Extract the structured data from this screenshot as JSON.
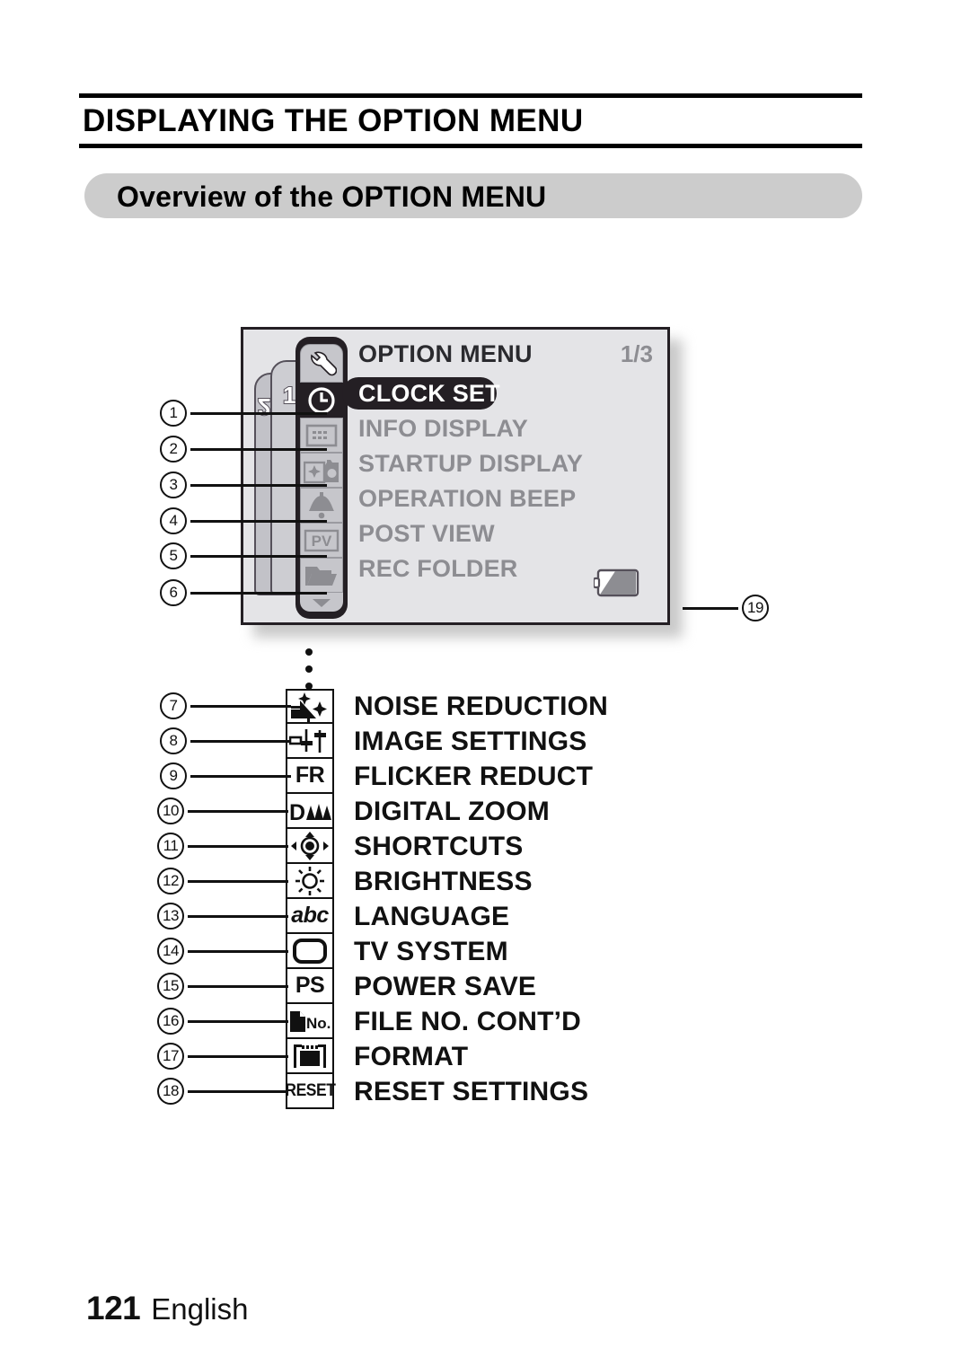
{
  "header": {
    "title": "DISPLAYING THE OPTION MENU",
    "section_title": "Overview of the OPTION MENU"
  },
  "lcd": {
    "menu_title": "OPTION MENU",
    "page_indicator": "1/3",
    "tabs": [
      "1",
      "2"
    ],
    "rows": [
      {
        "num": "1",
        "icon": "clock-icon",
        "label": "CLOCK SET",
        "selected": true
      },
      {
        "num": "2",
        "icon": "info-display-icon",
        "label": "INFO DISPLAY",
        "selected": false
      },
      {
        "num": "3",
        "icon": "startup-display-icon",
        "label": "STARTUP DISPLAY",
        "selected": false
      },
      {
        "num": "4",
        "icon": "bell-icon",
        "label": "OPERATION BEEP",
        "selected": false
      },
      {
        "num": "5",
        "icon": "pv-icon",
        "label": "POST VIEW",
        "selected": false
      },
      {
        "num": "6",
        "icon": "folder-icon",
        "label": "REC FOLDER",
        "selected": false
      }
    ],
    "top_icon": "wrench-icon",
    "scroll_icon": "chevron-down-icon",
    "battery": {
      "callout": "19",
      "icon": "battery-icon"
    }
  },
  "lower_list": [
    {
      "num": "7",
      "icon": "noise-reduction-icon",
      "label": "NOISE REDUCTION"
    },
    {
      "num": "8",
      "icon": "image-settings-icon",
      "label": "IMAGE SETTINGS"
    },
    {
      "num": "9",
      "icon": "fr-icon",
      "label": "FLICKER REDUCT",
      "icon_text": "FR"
    },
    {
      "num": "10",
      "icon": "digital-zoom-icon",
      "label": "DIGITAL ZOOM"
    },
    {
      "num": "11",
      "icon": "shortcuts-icon",
      "label": "SHORTCUTS"
    },
    {
      "num": "12",
      "icon": "brightness-icon",
      "label": "BRIGHTNESS"
    },
    {
      "num": "13",
      "icon": "language-icon",
      "label": "LANGUAGE",
      "icon_text": "abc"
    },
    {
      "num": "14",
      "icon": "tv-system-icon",
      "label": "TV SYSTEM"
    },
    {
      "num": "15",
      "icon": "ps-icon",
      "label": "POWER SAVE",
      "icon_text": "PS"
    },
    {
      "num": "16",
      "icon": "file-no-icon",
      "label": "FILE NO. CONT’D"
    },
    {
      "num": "17",
      "icon": "format-icon",
      "label": "FORMAT"
    },
    {
      "num": "18",
      "icon": "reset-icon",
      "label": "RESET SETTINGS",
      "icon_text": "RESET"
    }
  ],
  "footer": {
    "page_number": "121",
    "language": "English"
  },
  "colors": {
    "section_bar": "#cccccc",
    "lcd_background": "#e4e4e7",
    "lcd_text_dim": "#8d8d92",
    "lcd_frame": "#241f24",
    "ink": "#111111"
  }
}
